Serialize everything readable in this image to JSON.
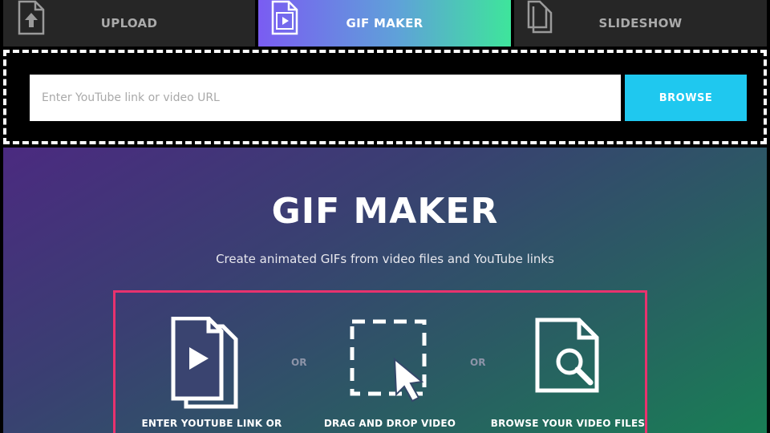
{
  "tabs": [
    {
      "label": "UPLOAD",
      "icon": "upload-file-icon",
      "active": false
    },
    {
      "label": "GIF MAKER",
      "icon": "video-file-icon",
      "active": true
    },
    {
      "label": "SLIDESHOW",
      "icon": "copy-files-icon",
      "active": false
    }
  ],
  "url_bar": {
    "placeholder": "Enter YouTube link or video URL",
    "value": "",
    "browse_label": "BROWSE"
  },
  "hero": {
    "title": "GIF MAKER",
    "subtitle": "Create animated GIFs from video files and YouTube links",
    "options": [
      {
        "label": "ENTER YOUTUBE LINK OR",
        "icon": "play-files-icon"
      },
      {
        "label": "DRAG AND DROP VIDEO",
        "icon": "drag-drop-cursor-icon"
      },
      {
        "label": "BROWSE YOUR VIDEO FILES",
        "icon": "file-search-icon"
      }
    ],
    "separator": "OR"
  },
  "colors": {
    "browse_button": "#1fc8ef",
    "options_border": "#e8326e",
    "tab_inactive": "#262626"
  }
}
